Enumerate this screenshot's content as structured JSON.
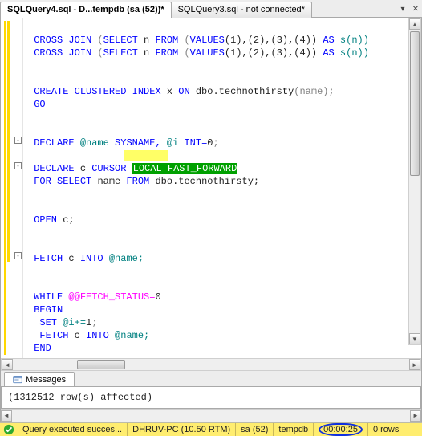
{
  "tabs": {
    "active": "SQLQuery4.sql - D...tempdb (sa (52))*",
    "inactive": "SQLQuery3.sql - not connected*"
  },
  "code": {
    "l1_a": "CROSS JOIN",
    "l1_b": "SELECT",
    "l1_c": "FROM",
    "l1_d": "VALUES",
    "l1_e": "AS",
    "l1_vals": "(1),(2),(3),(4))",
    "l1_alias": "s(n))",
    "l2_a": "CROSS JOIN",
    "l2_b": "SELECT",
    "l2_c": "FROM",
    "l2_d": "VALUES",
    "l2_e": "AS",
    "l2_vals": "(1),(2),(3),(4))",
    "l2_alias": "s(n))",
    "c1_a": "CREATE CLUSTERED INDEX",
    "c1_x": "x",
    "c1_on": "ON",
    "c1_obj": "dbo.technothirsty",
    "c1_col": "(name);",
    "go": "GO",
    "d1_a": "DECLARE",
    "d1_v": "@name",
    "d1_t": "SYSNAME,",
    "d1_v2": "@i",
    "d1_t2": "INT=",
    "d1_n": "0",
    "cur_a": "DECLARE",
    "cur_b": "c",
    "cur_c": "CURSOR",
    "cur_hl": "LOCAL FAST_FORWARD",
    "for_a": "FOR",
    "for_b": "SELECT",
    "for_c": "name",
    "for_d": "FROM",
    "for_e": "dbo.technothirsty;",
    "open_a": "OPEN",
    "open_b": "c;",
    "fetch_a": "FETCH",
    "fetch_b": "c",
    "fetch_c": "INTO",
    "fetch_d": "@name;",
    "while_a": "WHILE",
    "while_b": "@@FETCH_STATUS=",
    "while_c": "0",
    "begin": "BEGIN",
    "set_a": "SET",
    "set_b": "@i+=",
    "set_c": "1",
    "f2_a": "FETCH",
    "f2_b": "c",
    "f2_c": "INTO",
    "f2_d": "@name;",
    "end": "END",
    "semi": ";"
  },
  "messages": {
    "tab": "Messages",
    "text": "(1312512 row(s) affected)"
  },
  "status": {
    "ok": "Query executed succes...",
    "server": "DHRUV-PC (10.50 RTM)",
    "login": "sa (52)",
    "db": "tempdb",
    "time": "00:00:25",
    "rows": "0 rows"
  }
}
